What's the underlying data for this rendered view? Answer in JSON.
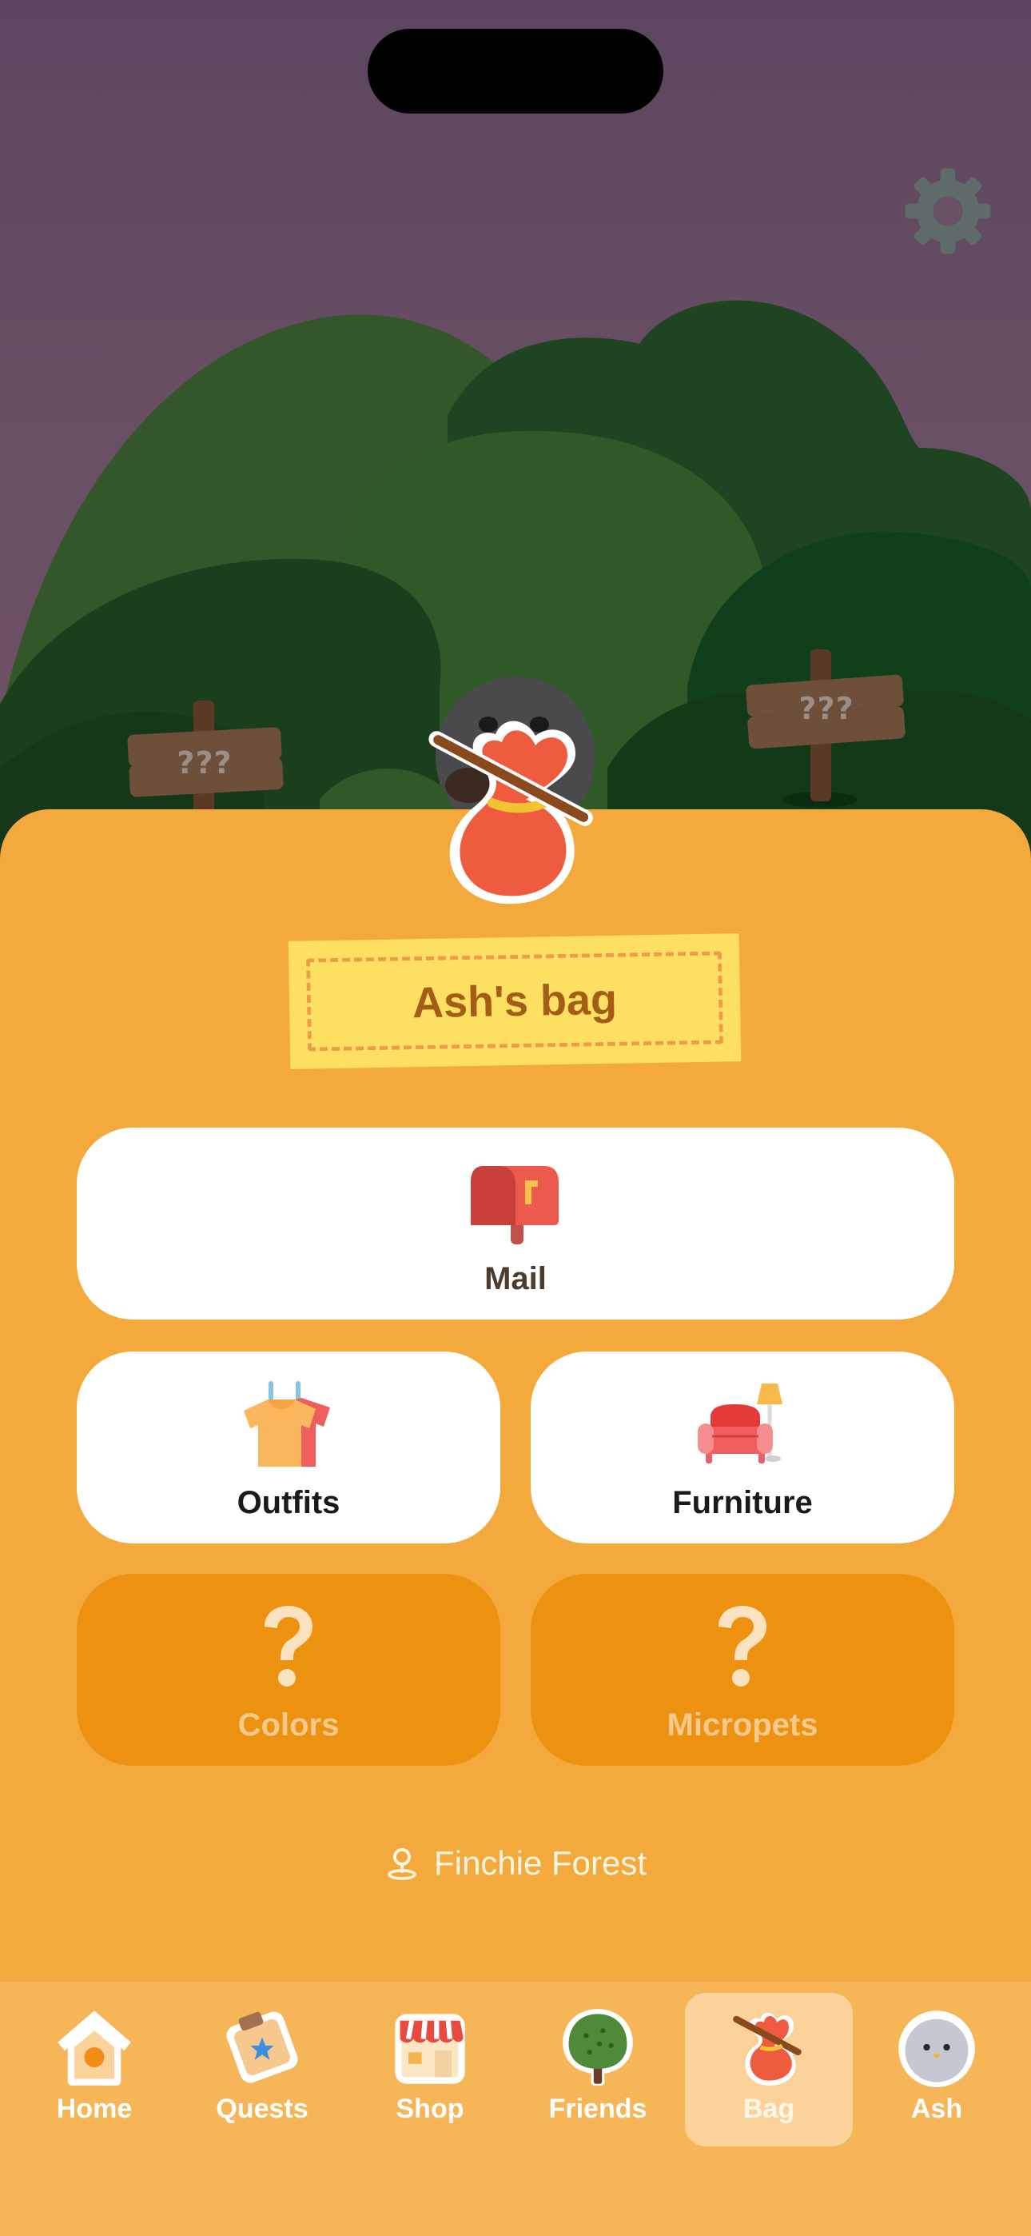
{
  "scene": {
    "signs": [
      {
        "label": "???"
      },
      {
        "label": "???"
      }
    ]
  },
  "header": {
    "settings_icon": "gear-icon",
    "bag_title": "Ash's bag"
  },
  "cards": {
    "mail": {
      "label": "Mail",
      "icon": "mailbox-icon"
    },
    "outfits": {
      "label": "Outfits",
      "icon": "shirts-icon"
    },
    "furniture": {
      "label": "Furniture",
      "icon": "sofa-lamp-icon"
    },
    "colors": {
      "label": "Colors",
      "icon": "question-icon",
      "locked": true
    },
    "micropets": {
      "label": "Micropets",
      "icon": "question-icon",
      "locked": true
    }
  },
  "location": {
    "icon": "map-pin-icon",
    "name": "Finchie Forest"
  },
  "nav": {
    "items": [
      {
        "label": "Home",
        "icon": "birdhouse-icon"
      },
      {
        "label": "Quests",
        "icon": "quest-scroll-icon"
      },
      {
        "label": "Shop",
        "icon": "shop-icon"
      },
      {
        "label": "Friends",
        "icon": "tree-icon"
      },
      {
        "label": "Bag",
        "icon": "bag-icon",
        "active": true
      },
      {
        "label": "Ash",
        "icon": "bird-avatar-icon"
      }
    ]
  },
  "colors": {
    "panel": "#f3a93b",
    "card_locked": "#ec9110",
    "nav_bar": "#f6b657",
    "nav_active": "#fbd39a",
    "title_tag": "#fde062"
  }
}
